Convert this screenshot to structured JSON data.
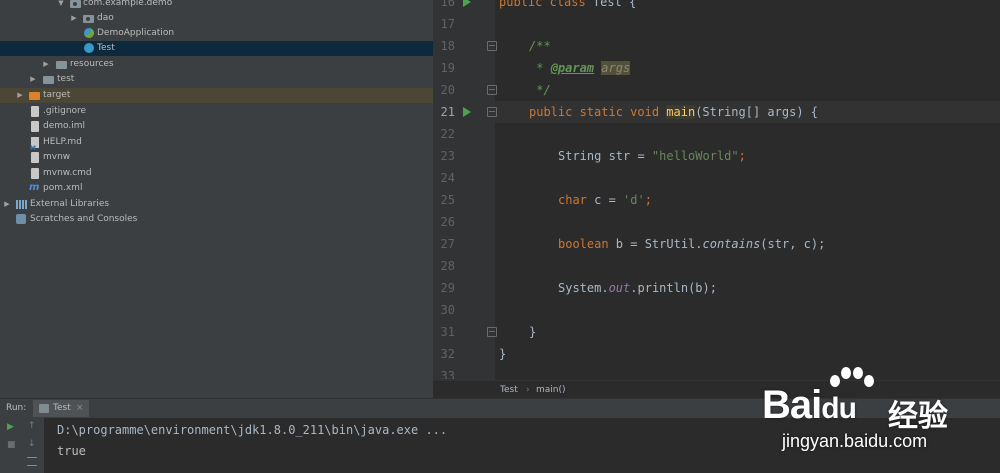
{
  "project_tree": [
    {
      "label": "com.example.demo",
      "icon": "package-icon",
      "arrow": "▼"
    },
    {
      "label": "dao",
      "icon": "package-icon",
      "arrow": "▶"
    },
    {
      "label": "DemoApplication",
      "icon": "spring-class-icon",
      "arrow": ""
    },
    {
      "label": "Test",
      "icon": "class-icon",
      "arrow": "",
      "state": "selected"
    },
    {
      "label": "resources",
      "icon": "folder-icon",
      "arrow": "▶"
    },
    {
      "label": "test",
      "icon": "folder-icon",
      "arrow": "▶"
    },
    {
      "label": "target",
      "icon": "folder-orange-icon",
      "arrow": "▶",
      "state": "highlighted"
    },
    {
      "label": ".gitignore",
      "icon": "file-icon",
      "arrow": ""
    },
    {
      "label": "demo.iml",
      "icon": "file-icon",
      "arrow": ""
    },
    {
      "label": "HELP.md",
      "icon": "markdown-icon",
      "arrow": ""
    },
    {
      "label": "mvnw",
      "icon": "file-icon",
      "arrow": ""
    },
    {
      "label": "mvnw.cmd",
      "icon": "file-icon",
      "arrow": ""
    },
    {
      "label": "pom.xml",
      "icon": "maven-icon",
      "arrow": ""
    },
    {
      "label": "External Libraries",
      "icon": "library-icon",
      "arrow": "▶"
    },
    {
      "label": "Scratches and Consoles",
      "icon": "scratch-icon",
      "arrow": ""
    }
  ],
  "editor": {
    "line_numbers": [
      "16",
      "17",
      "18",
      "19",
      "20",
      "21",
      "22",
      "23",
      "24",
      "25",
      "26",
      "27",
      "28",
      "29",
      "30",
      "31",
      "32",
      "33"
    ],
    "current_line": "21",
    "code": {
      "l16_kw": "public class ",
      "l16_rest": "Test {",
      "l18": "/**",
      "l19_star": " * ",
      "l19_tag": "@param",
      "l19_param": "args",
      "l20": " */",
      "l21_kw": "public static void ",
      "l21_fn": "main",
      "l21_rest": "(String[] args) {",
      "l23_a": "String str = ",
      "l23_str": "\"helloWorld\"",
      "l23_b": ";",
      "l25_kw": "char ",
      "l25_a": "c = ",
      "l25_str": "'d'",
      "l25_b": ";",
      "l27_kw": "boolean ",
      "l27_a": "b = StrUtil.",
      "l27_it": "contains",
      "l27_b": "(str, c);",
      "l29_a": "System.",
      "l29_fld": "out",
      "l29_b": ".println(b);",
      "l31": "}",
      "l32": "}"
    },
    "breadcrumb": [
      "Test",
      "main()"
    ],
    "breadcrumb_sep": "›"
  },
  "run_panel": {
    "label": "Run:",
    "tab_label": "Test",
    "tab_close": "×",
    "console_lines": [
      "D:\\programme\\environment\\jdk1.8.0_211\\bin\\java.exe ...",
      "true"
    ],
    "toolbar": {
      "up": "↑",
      "down": "↓",
      "rerun": "▶",
      "stop": "■"
    }
  },
  "watermark": {
    "brand": "Bai",
    "brand_tail": "du",
    "cn": "经验",
    "url": "jingyan.baidu.com"
  },
  "colors": {
    "keyword": "#cc7832",
    "string": "#6a8759",
    "doc": "#629755",
    "selection": "#0d293e",
    "run": "#4ea24e"
  }
}
